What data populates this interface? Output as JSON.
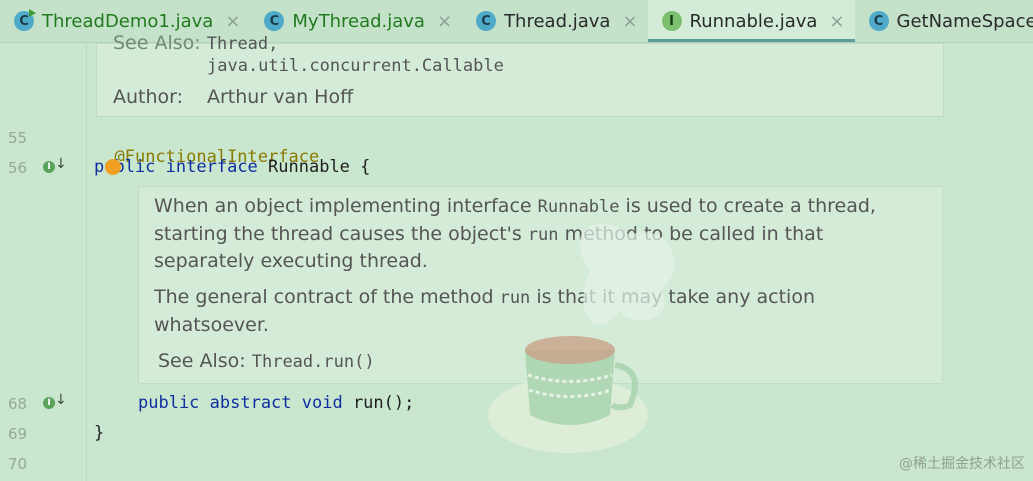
{
  "tabs": [
    {
      "label": "ThreadDemo1.java",
      "icon": "class-run-icon",
      "modified": true,
      "active": false
    },
    {
      "label": "MyThread.java",
      "icon": "class-icon",
      "modified": true,
      "active": false
    },
    {
      "label": "Thread.java",
      "icon": "class-icon",
      "modified": false,
      "active": false
    },
    {
      "label": "Runnable.java",
      "icon": "interface-icon",
      "modified": false,
      "active": true
    },
    {
      "label": "GetNameSpaceMessage.class",
      "icon": "class-icon",
      "modified": false,
      "active": false
    }
  ],
  "top_doc": {
    "see_also_label": "See Also:",
    "see_also_link": "Thread,",
    "callable_link": "java.util.concurrent.Callable",
    "author_label": "Author:",
    "author_value": "Arthur van Hoff"
  },
  "lines": {
    "l55": "55",
    "l56": "56",
    "l68": "68",
    "l69": "69",
    "l70": "70"
  },
  "code": {
    "annotation": "@FunctionalInterface",
    "decl_kw1": "public",
    "decl_kw2": "interface",
    "decl_rest": " Runnable {",
    "run_kw": "public abstract void",
    "run_rest": " run();",
    "close_brace": "}"
  },
  "doc": {
    "p1_a": "When an object implementing interface ",
    "p1_code": "Runnable",
    "p1_b": " is used to create a thread,",
    "p1_line2_a": "starting the thread causes the object's ",
    "p1_line2_code": "run",
    "p1_line2_b": " method to be called in that",
    "p1_line3": "separately executing thread.",
    "p2_a": "The general contract of the method ",
    "p2_code": "run",
    "p2_b": " is that it may take any action",
    "p2_line2": "whatsoever.",
    "see_also_label": "See Also:",
    "see_also_link": "Thread.run()"
  },
  "watermark": "@稀土掘金技术社区"
}
